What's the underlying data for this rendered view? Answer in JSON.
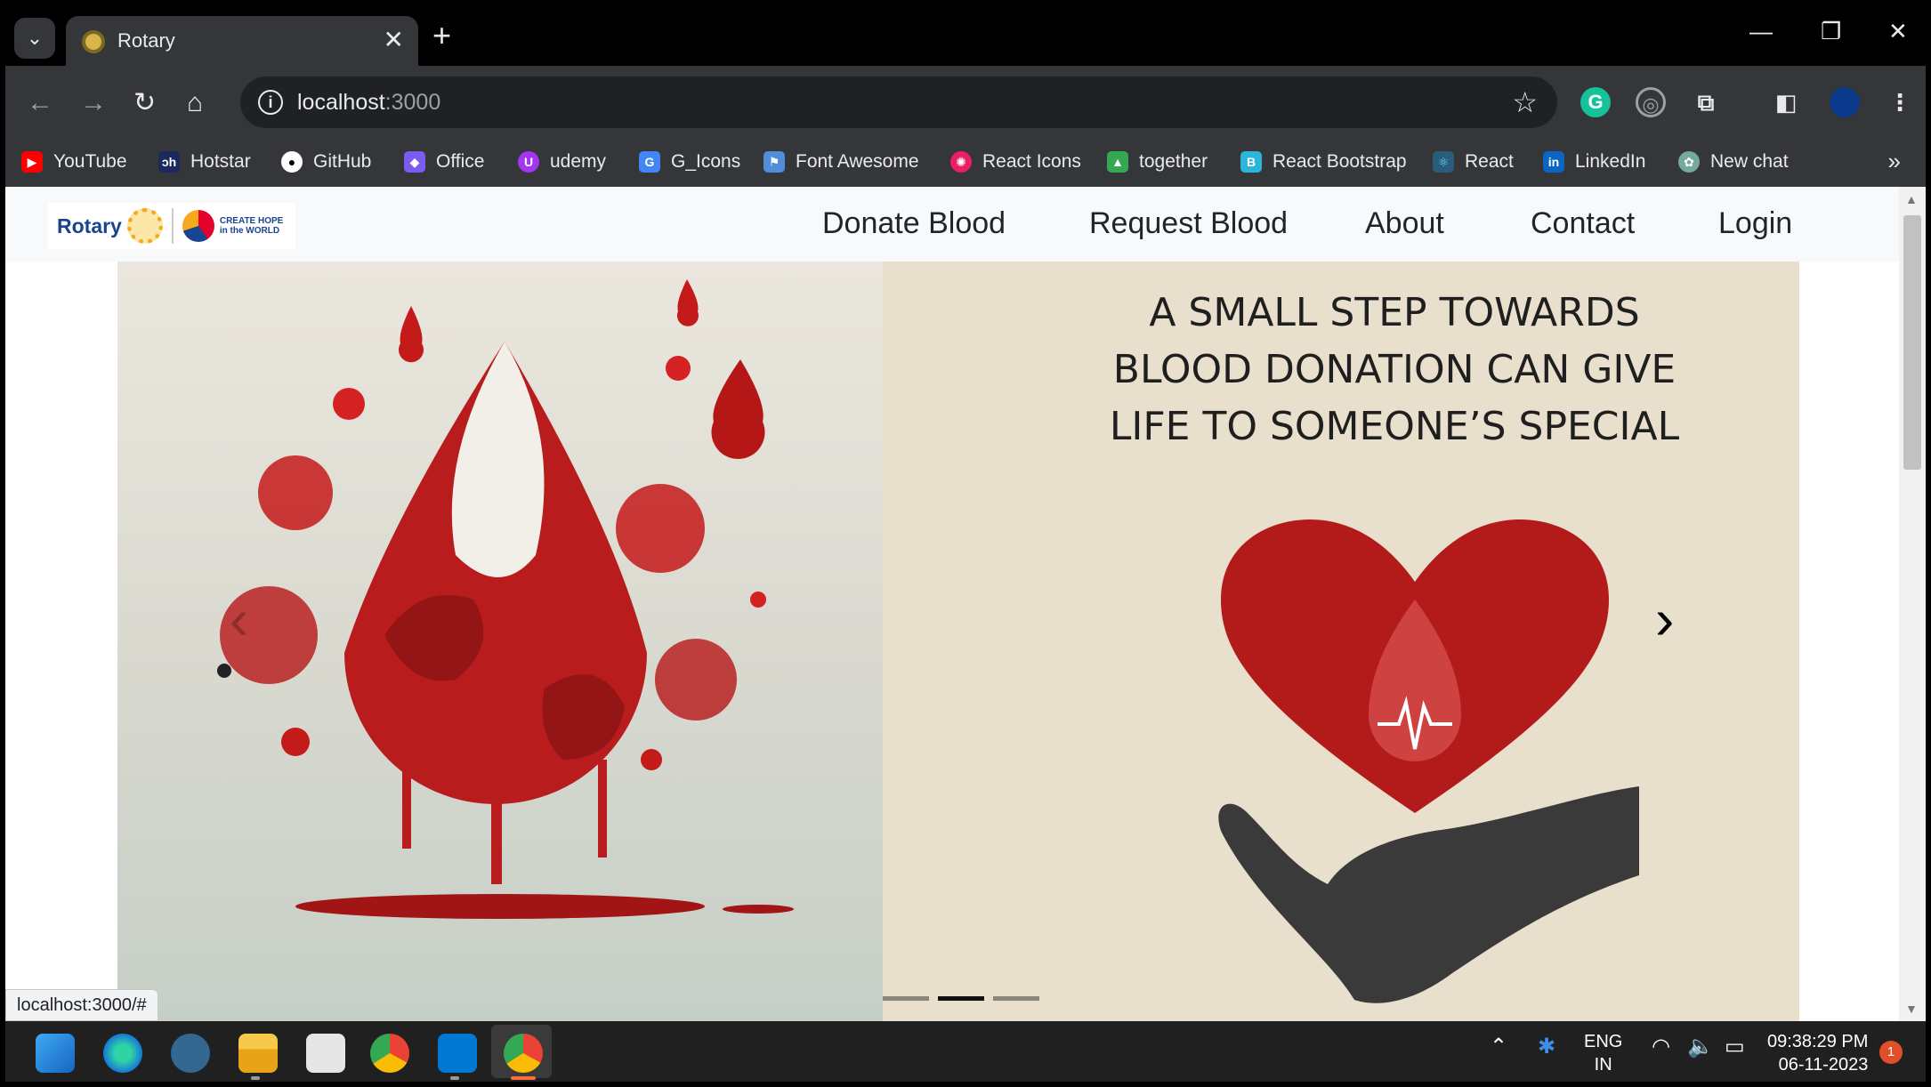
{
  "browser": {
    "tab_title": "Rotary",
    "tab_close": "✕",
    "new_tab": "+",
    "url_host": "localhost",
    "url_port": ":3000",
    "window_controls": [
      "—",
      "❐",
      "✕"
    ]
  },
  "bookmarks": [
    {
      "label": "YouTube",
      "icon": "youtube-icon",
      "color": "#ff0000",
      "glyph": "▶"
    },
    {
      "label": "Hotstar",
      "icon": "hotstar-icon",
      "color": "#1b2a5e",
      "glyph": "ɔh"
    },
    {
      "label": "GitHub",
      "icon": "github-icon",
      "color": "#ffffff",
      "glyph": "●"
    },
    {
      "label": "Office",
      "icon": "office-icon",
      "color": "#7b5cf0",
      "glyph": "◆"
    },
    {
      "label": "udemy",
      "icon": "udemy-icon",
      "color": "#a435f0",
      "glyph": "U"
    },
    {
      "label": "G_Icons",
      "icon": "g-icons-icon",
      "color": "#4285f4",
      "glyph": "G"
    },
    {
      "label": "Font Awesome",
      "icon": "font-awesome-icon",
      "color": "#538dd7",
      "glyph": "⚑"
    },
    {
      "label": "React Icons",
      "icon": "react-icons-icon",
      "color": "#e91e63",
      "glyph": "✺"
    },
    {
      "label": "together",
      "icon": "together-icon",
      "color": "#34a853",
      "glyph": "▲"
    },
    {
      "label": "React Bootstrap",
      "icon": "react-bootstrap-icon",
      "color": "#41e0fd",
      "glyph": "B"
    },
    {
      "label": "React",
      "icon": "react-icon",
      "color": "#61dafb",
      "glyph": "⚛"
    },
    {
      "label": "LinkedIn",
      "icon": "linkedin-icon",
      "color": "#0a66c2",
      "glyph": "in"
    },
    {
      "label": "New chat",
      "icon": "chatgpt-icon",
      "color": "#74aa9c",
      "glyph": "✿"
    }
  ],
  "bookmarks_more": "»",
  "site": {
    "logo_text": "Rotary",
    "logo_tagline": "CREATE HOPE in the WORLD",
    "nav": [
      "Donate Blood",
      "Request Blood",
      "About",
      "Contact",
      "Login"
    ]
  },
  "carousel": {
    "headline": [
      "A SMALL STEP TOWARDS",
      "BLOOD DONATION CAN GIVE",
      "LIFE TO SOMEONE’S SPECIAL"
    ],
    "prev": "‹",
    "next": "›",
    "active_index": 1,
    "indicator_count": 3
  },
  "status_url": "localhost:3000/#",
  "taskbar": {
    "language": "ENG",
    "region": "IN",
    "time": "09:38:29 PM",
    "date": "06-11-2023",
    "notifications": "1"
  }
}
